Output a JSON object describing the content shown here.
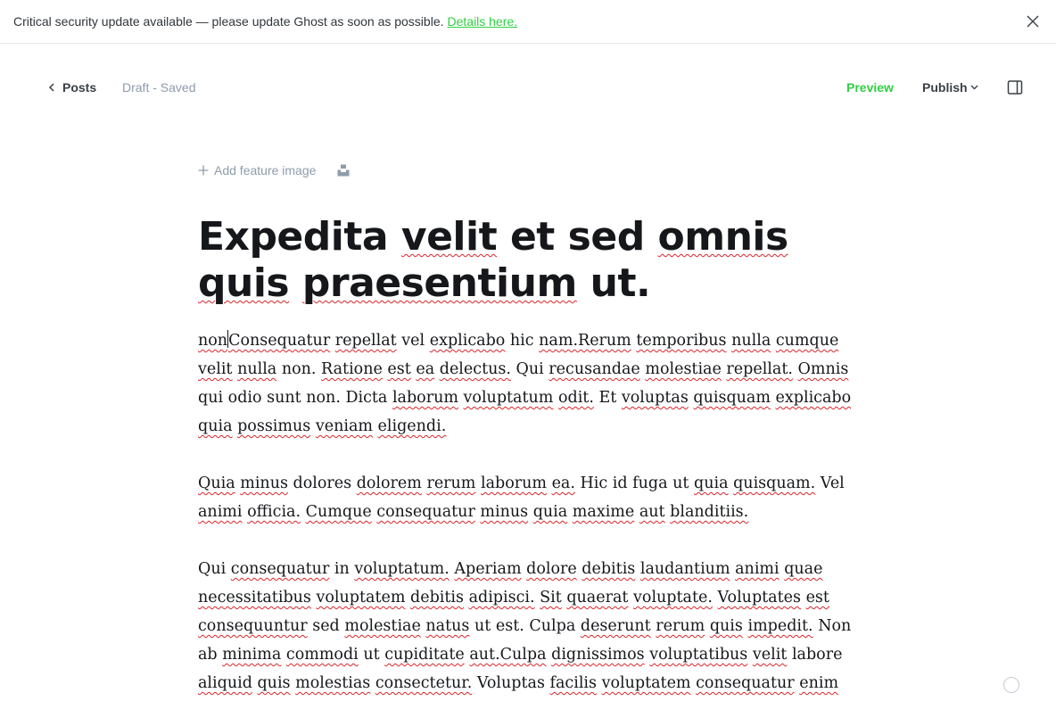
{
  "alert": {
    "message": "Critical security update available — please update Ghost as soon as possible.",
    "link_label": "Details here."
  },
  "header": {
    "back_label": "Posts",
    "status": "Draft - Saved",
    "preview_label": "Preview",
    "publish_label": "Publish"
  },
  "feature_image": {
    "label": "Add feature image"
  },
  "post": {
    "title_words": [
      "Expedita",
      "velit",
      "et",
      "sed",
      "omnis",
      "quis",
      "praesentium",
      "ut."
    ],
    "paragraph1_first": "non",
    "paragraph1_rest": [
      "Consequatur",
      "repellat",
      "vel",
      "explicabo",
      "hic",
      "nam.Rerum",
      "temporibus",
      "nulla",
      "cumque",
      "velit",
      "nulla",
      "non.",
      "Ratione",
      "est",
      "ea",
      "delectus.",
      "Qui",
      "recusandae",
      "molestiae",
      "repellat.",
      "Omnis",
      "qui",
      "odio",
      "sunt",
      "non.",
      "Dicta",
      "laborum",
      "voluptatum",
      "odit.",
      "Et",
      "voluptas",
      "quisquam",
      "explicabo",
      "quia",
      "possimus",
      "veniam",
      "eligendi."
    ],
    "paragraph2": [
      "Quia",
      "minus",
      "dolores",
      "dolorem",
      "rerum",
      "laborum",
      "ea.",
      "Hic",
      "id",
      "fuga",
      "ut",
      "quia",
      "quisquam.",
      "Vel",
      "animi",
      "officia.",
      "Cumque",
      "consequatur",
      "minus",
      "quia",
      "maxime",
      "aut",
      "blanditiis."
    ],
    "paragraph3": [
      "Qui",
      "consequatur",
      "in",
      "voluptatum.",
      "Aperiam",
      "dolore",
      "debitis",
      "laudantium",
      "animi",
      "quae",
      "necessitatibus",
      "voluptatem",
      "debitis",
      "adipisci.",
      "Sit",
      "quaerat",
      "voluptate.",
      "Voluptates",
      "est",
      "consequuntur",
      "sed",
      "molestiae",
      "natus",
      "ut",
      "est.",
      "Culpa",
      "deserunt",
      "rerum",
      "quis",
      "impedit.",
      "Non",
      "ab",
      "minima",
      "commodi",
      "ut",
      "cupiditate",
      "aut.Culpa",
      "dignissimos",
      "voluptatibus",
      "velit",
      "labore",
      "aliquid",
      "quis",
      "molestias",
      "consectetur.",
      "Voluptas",
      "facilis",
      "voluptatem",
      "consequatur",
      "enim"
    ]
  },
  "spellcheck_plain": [
    "et",
    "sed",
    "ut.",
    "hic",
    "non.",
    "Qui",
    "qui",
    "odio",
    "sunt",
    "Dicta",
    "Et",
    "dolores",
    "Hic",
    "id",
    "fuga",
    "ut",
    "in",
    "sed",
    "est.",
    "Culpa",
    "Non",
    "ab",
    "ut",
    "labore",
    "vel",
    "Vel",
    "Voluptas"
  ],
  "colors": {
    "accent": "#30cf43",
    "text": "#15171a",
    "muted": "#8e9cac",
    "spellcheck": "#d9252a"
  }
}
